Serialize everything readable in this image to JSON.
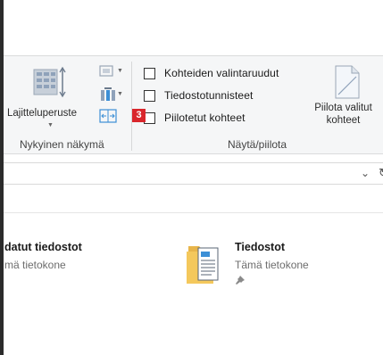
{
  "ribbon": {
    "current_view": {
      "sort_button_label": "Lajitteluperuste",
      "group_label": "Nykyinen näkymä"
    },
    "show_hide": {
      "checkboxes": [
        {
          "label": "Kohteiden valintaruudut",
          "checked": false
        },
        {
          "label": "Tiedostotunnisteet",
          "checked": false
        },
        {
          "label": "Piilotetut kohteet",
          "checked": false
        }
      ],
      "hide_selected_label_line1": "Piilota valitut",
      "hide_selected_label_line2": "kohteet",
      "group_label": "Näytä/piilota"
    },
    "step_badge": "3"
  },
  "address_bar": {
    "chevron_icon": "chevron-down-icon",
    "refresh_icon": "refresh-icon"
  },
  "quick_access": {
    "items": [
      {
        "title": "datut tiedostot",
        "location": "mä tietokone"
      },
      {
        "title": "Tiedostot",
        "location": "Tämä tietokone",
        "pinned": true
      }
    ]
  },
  "colors": {
    "ribbon_bg": "#f5f6f7",
    "badge_red": "#d9262c",
    "accent_blue": "#3c8fd6",
    "folder_yellow": "#f4c85c"
  }
}
